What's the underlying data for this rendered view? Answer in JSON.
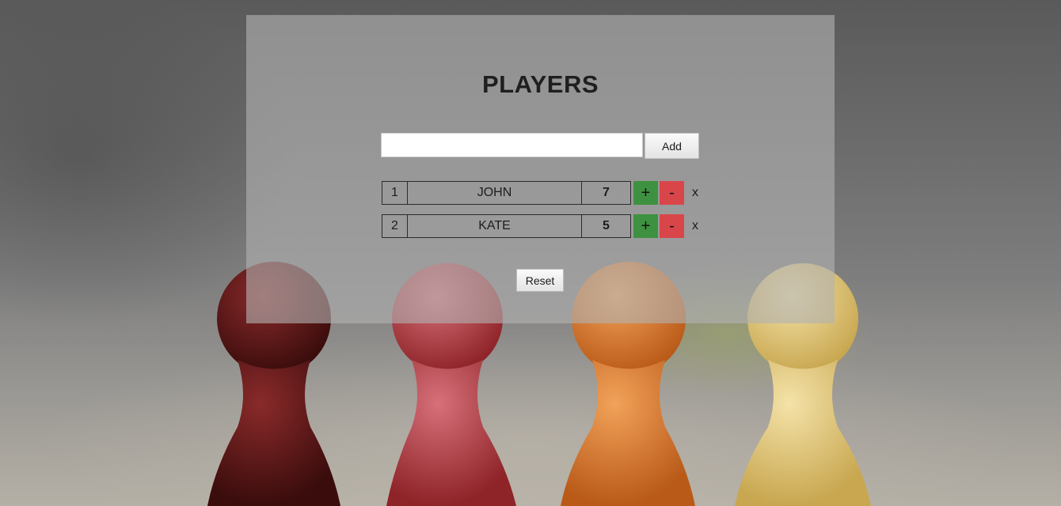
{
  "title": "PLAYERS",
  "input": {
    "value": "",
    "placeholder": ""
  },
  "add_label": "Add",
  "reset_label": "Reset",
  "players": [
    {
      "index": "1",
      "name": "JOHN",
      "score": "7"
    },
    {
      "index": "2",
      "name": "KATE",
      "score": "5"
    }
  ],
  "controls": {
    "plus": "+",
    "minus": "-",
    "remove": "x"
  },
  "colors": {
    "plus": "#3e9140",
    "minus": "#d9464a",
    "panel": "rgba(178,178,178,0.62)"
  },
  "background": {
    "description_icon": "wooden-pawns-photo",
    "pawn_colors": [
      "#5a1414",
      "#a8323a",
      "#d8722a",
      "#e2c778"
    ]
  }
}
